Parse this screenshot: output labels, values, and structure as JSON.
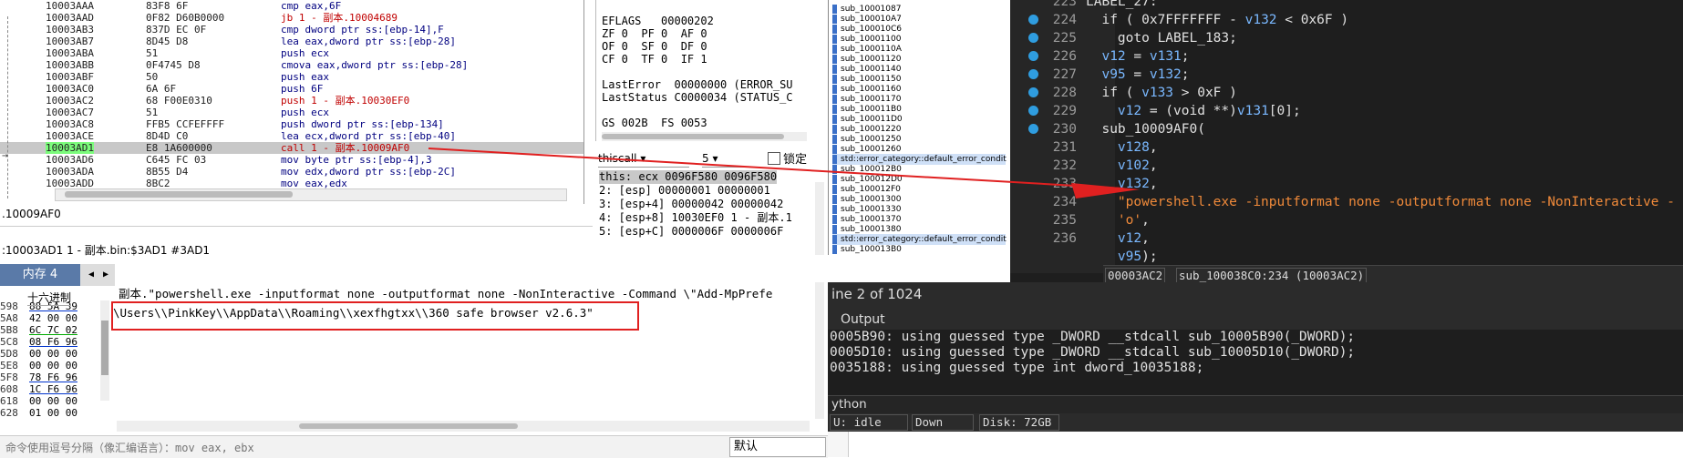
{
  "disasm": {
    "rows": [
      {
        "addr": "10003AAA",
        "bytes": "83F8 6F",
        "instr": "cmp eax,6F",
        "red": false
      },
      {
        "addr": "10003AAD",
        "bytes": "0F82 D60B0000",
        "instr": "jb 1 - 副本.10004689",
        "red": true
      },
      {
        "addr": "10003AB3",
        "bytes": "837D EC 0F",
        "instr": "cmp dword ptr ss:[ebp-14],F",
        "red": false
      },
      {
        "addr": "10003AB7",
        "bytes": "8D45 D8",
        "instr": "lea eax,dword ptr ss:[ebp-28]",
        "red": false
      },
      {
        "addr": "10003ABA",
        "bytes": "51",
        "instr": "push ecx",
        "red": false
      },
      {
        "addr": "10003ABB",
        "bytes": "0F4745 D8",
        "instr": "cmova eax,dword ptr ss:[ebp-28]",
        "red": false
      },
      {
        "addr": "10003ABF",
        "bytes": "50",
        "instr": "push eax",
        "red": false
      },
      {
        "addr": "10003AC0",
        "bytes": "6A 6F",
        "instr": "push 6F",
        "red": false
      },
      {
        "addr": "10003AC2",
        "bytes": "68 F00E0310",
        "instr": "push 1 - 副本.10030EF0",
        "red": true
      },
      {
        "addr": "10003AC7",
        "bytes": "51",
        "instr": "push ecx",
        "red": false
      },
      {
        "addr": "10003AC8",
        "bytes": "FFB5 CCFEFFFF",
        "instr": "push dword ptr ss:[ebp-134]",
        "red": false
      },
      {
        "addr": "10003ACE",
        "bytes": "8D4D C0",
        "instr": "lea ecx,dword ptr ss:[ebp-40]",
        "red": false
      },
      {
        "addr": "10003AD1",
        "bytes": "E8 1A600000",
        "instr": "call 1 - 副本.10009AF0",
        "red": true
      },
      {
        "addr": "10003AD6",
        "bytes": "C645 FC 03",
        "instr": "mov byte ptr ss:[ebp-4],3",
        "red": false
      },
      {
        "addr": "10003ADA",
        "bytes": "8B55 D4",
        "instr": "mov edx,dword ptr ss:[ebp-2C]",
        "red": false
      },
      {
        "addr": "10003ADD",
        "bytes": "8BC2",
        "instr": "mov eax,edx",
        "red": false
      }
    ],
    "arrow_glyph": "→",
    "info_label": ".10009AF0",
    "info_path": ":10003AD1 1 - 副本.bin:$3AD1 #3AD1"
  },
  "registers": {
    "lines": [
      "EFLAGS   00000202",
      "ZF 0  PF 0  AF 0",
      "OF 0  SF 0  DF 0",
      "CF 0  TF 0  IF 1",
      "",
      "LastError  00000000 (ERROR_SU",
      "LastStatus C0000034 (STATUS_C",
      "",
      "GS 002B  FS 0053"
    ]
  },
  "stack": {
    "callconv": "thiscall",
    "argcount": "5",
    "lock_label": "锁定",
    "lines": [
      "this: ecx 0096F580 0096F580",
      "2: [esp] 00000001 00000001",
      "3: [esp+4] 00000042 00000042",
      "4: [esp+8] 10030EF0 1 - 副本.1",
      "5: [esp+C] 0000006F 0000006F"
    ]
  },
  "dump": {
    "tab_label": "内存 4",
    "prev": "◀",
    "next": "▶",
    "header": "十六进制",
    "rows": [
      {
        "a": "598",
        "b": "88 5A 39"
      },
      {
        "a": "5A8",
        "b": "42 00 00"
      },
      {
        "a": "5B8",
        "b": "6C 7C 02"
      },
      {
        "a": "5C8",
        "b": "08 F6 96"
      },
      {
        "a": "5D8",
        "b": "00 00 00"
      },
      {
        "a": "5E8",
        "b": "00 00 00"
      },
      {
        "a": "5F8",
        "b": "78 F6 96"
      },
      {
        "a": "608",
        "b": "1C F6 96"
      },
      {
        "a": "618",
        "b": "00 00 00"
      },
      {
        "a": "628",
        "b": "01 00 00"
      }
    ]
  },
  "strpane": {
    "line1": "副本.\"powershell.exe -inputformat none -outputformat none -NonInteractive -Command \\\"Add-MpPrefe",
    "line2": "\\Users\\\\PinkKey\\\\AppData\\\\Roaming\\\\xexfhgtxx\\\\360 safe browser v2.6.3\""
  },
  "cmdbar": {
    "placeholder": "命令使用逗号分隔（像汇编语言）：mov eax, ebx",
    "default_label": "默认"
  },
  "funclist": {
    "items": [
      "sub_10001087",
      "sub_100010A7",
      "sub_100010C6",
      "sub_10001100",
      "sub_1000110A",
      "sub_10001120",
      "sub_10001140",
      "sub_10001150",
      "sub_10001160",
      "sub_10001170",
      "sub_100011B0",
      "sub_100011D0",
      "sub_10001220",
      "sub_10001250",
      "sub_10001260",
      "std::error_category::default_error_condit",
      "sub_100012B0",
      "sub_100012D0",
      "sub_100012F0",
      "sub_10001300",
      "sub_10001330",
      "sub_10001370",
      "sub_10001380",
      "std::error_category::default_error_condit",
      "sub_100013B0"
    ]
  },
  "pseudocode": {
    "lines": [
      {
        "ln": "223",
        "dot": false,
        "parts": [
          [
            "id",
            "LABEL_27:"
          ]
        ]
      },
      {
        "ln": "224",
        "dot": true,
        "parts": [
          [
            "kw",
            "  if ( 0x7FFFFFFF - "
          ],
          [
            "var",
            "v132"
          ],
          [
            "kw",
            " < 0x6F )"
          ]
        ]
      },
      {
        "ln": "225",
        "dot": true,
        "parts": [
          [
            "kw",
            "    goto LABEL_183;"
          ]
        ]
      },
      {
        "ln": "226",
        "dot": true,
        "parts": [
          [
            "var",
            "  v12"
          ],
          [
            "kw",
            " = "
          ],
          [
            "var",
            "v131"
          ],
          [
            "kw",
            ";"
          ]
        ]
      },
      {
        "ln": "227",
        "dot": true,
        "parts": [
          [
            "var",
            "  v95"
          ],
          [
            "kw",
            " = "
          ],
          [
            "var",
            "v132"
          ],
          [
            "kw",
            ";"
          ]
        ]
      },
      {
        "ln": "228",
        "dot": true,
        "parts": [
          [
            "kw",
            "  if ( "
          ],
          [
            "var",
            "v133"
          ],
          [
            "kw",
            " > 0xF )"
          ]
        ]
      },
      {
        "ln": "229",
        "dot": true,
        "parts": [
          [
            "var",
            "    v12"
          ],
          [
            "kw",
            " = (void **)"
          ],
          [
            "var",
            "v131"
          ],
          [
            "kw",
            "[0];"
          ]
        ]
      },
      {
        "ln": "230",
        "dot": true,
        "parts": [
          [
            "kw",
            "  sub_10009AF0("
          ]
        ]
      },
      {
        "ln": "231",
        "dot": false,
        "parts": [
          [
            "var",
            "    v128"
          ],
          [
            "kw",
            ","
          ]
        ]
      },
      {
        "ln": "232",
        "dot": false,
        "parts": [
          [
            "var",
            "    v102"
          ],
          [
            "kw",
            ","
          ]
        ]
      },
      {
        "ln": "233",
        "dot": false,
        "parts": [
          [
            "var",
            "    v132"
          ],
          [
            "kw",
            ","
          ]
        ]
      },
      {
        "ln": "234",
        "dot": false,
        "parts": [
          [
            "str",
            "    \"powershell.exe -inputformat none -outputformat none -NonInteractive -"
          ]
        ]
      },
      {
        "ln": "235",
        "dot": false,
        "parts": [
          [
            "str",
            "    'o'"
          ],
          [
            "kw",
            ","
          ]
        ]
      },
      {
        "ln": "236",
        "dot": false,
        "parts": [
          [
            "var",
            "    v12"
          ],
          [
            "kw",
            ","
          ]
        ]
      },
      {
        "ln": "",
        "dot": false,
        "parts": [
          [
            "var",
            "    v95"
          ],
          [
            "kw",
            ");"
          ]
        ]
      }
    ],
    "status_left": "00003AC2",
    "status_right": "sub_100038C0:234 (10003AC2)"
  },
  "linebar": {
    "text": "ine 2 of 1024"
  },
  "output": {
    "header": "Output",
    "lines": [
      "0005B90: using guessed type _DWORD __stdcall sub_10005B90(_DWORD);",
      "0005D10: using guessed type _DWORD __stdcall sub_10005D10(_DWORD);",
      "0035188: using guessed type int dword_10035188;"
    ],
    "python_label": "ython",
    "status": {
      "au": "U:  idle",
      "dir": "Down",
      "disk": "Disk: 72GB"
    }
  },
  "colors": {
    "highlight_red": "#e02020",
    "ida_string": "#f08a3a",
    "ida_var": "#7ab8ff",
    "selected_addr": "#7cfc7c"
  }
}
